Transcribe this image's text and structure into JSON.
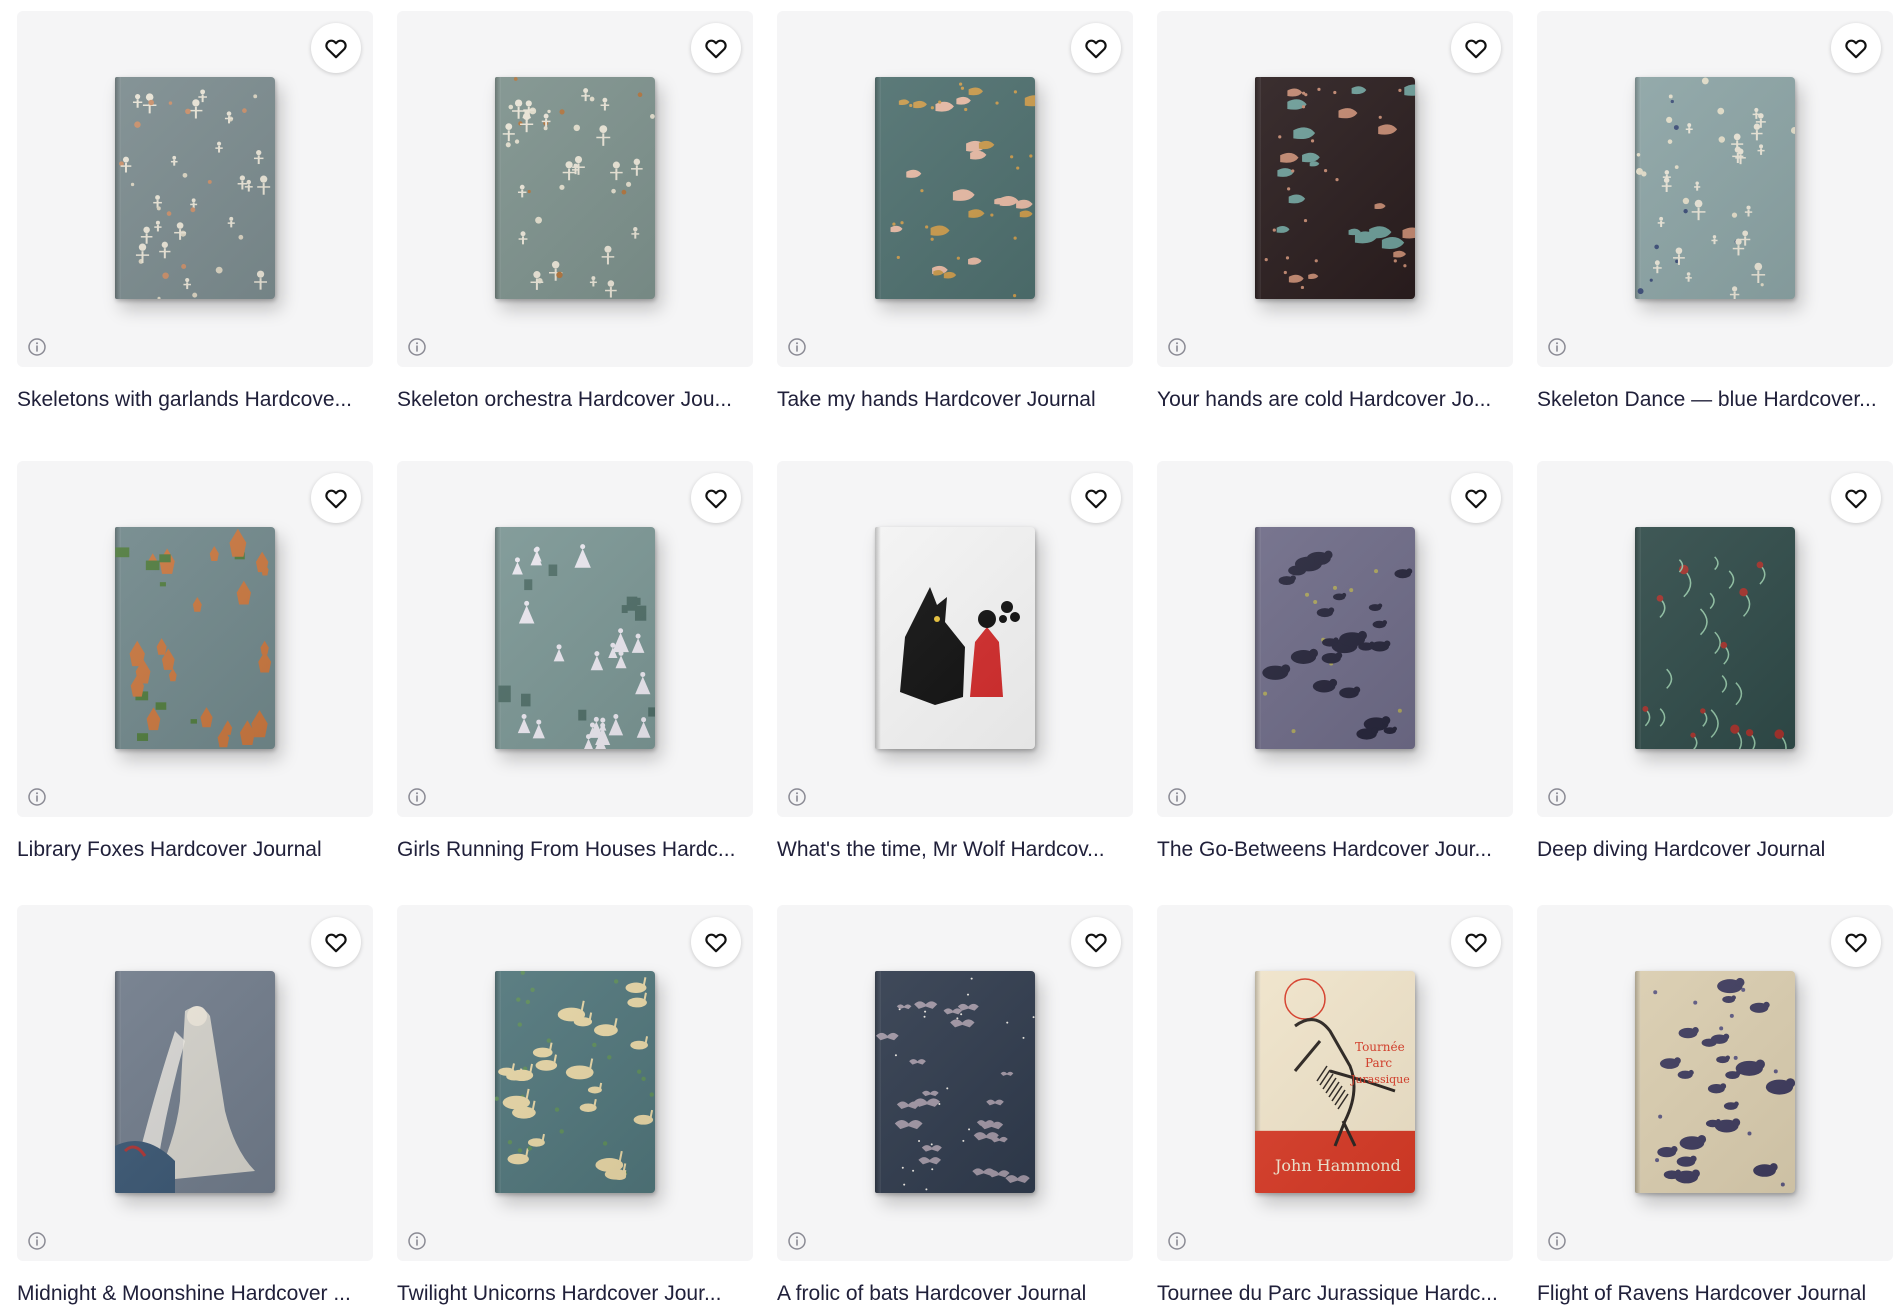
{
  "products": [
    {
      "title": "Skeletons with garlands Hardcove...",
      "cover": {
        "bg": "#7b8b8e",
        "accent": "#c98f6a",
        "accent2": "#d9d3c1",
        "motif": "skeleton"
      }
    },
    {
      "title": "Skeleton orchestra Hardcover Jou...",
      "cover": {
        "bg": "#7d918c",
        "accent": "#b0753f",
        "accent2": "#e0dccb",
        "motif": "skeleton"
      }
    },
    {
      "title": "Take my hands Hardcover Journal",
      "cover": {
        "bg": "#4e6f6e",
        "accent": "#e6b9a4",
        "accent2": "#c99a4c",
        "motif": "hands"
      }
    },
    {
      "title": "Your hands are cold Hardcover Jo...",
      "cover": {
        "bg": "#2a1d1e",
        "accent": "#6c9c97",
        "accent2": "#c0876f",
        "motif": "hands"
      }
    },
    {
      "title": "Skeleton Dance — blue Hardcover...",
      "cover": {
        "bg": "#8ba3a4",
        "accent": "#3c4d77",
        "accent2": "#e1dcc8",
        "motif": "skeleton"
      }
    },
    {
      "title": "Library Foxes Hardcover Journal",
      "cover": {
        "bg": "#70878a",
        "accent": "#c7763f",
        "accent2": "#4f7a3d",
        "motif": "fox"
      }
    },
    {
      "title": "Girls Running From Houses Hardc...",
      "cover": {
        "bg": "#7a9593",
        "accent": "#e9e6ee",
        "accent2": "#4f6d67",
        "motif": "girls"
      }
    },
    {
      "title": "What's the time, Mr Wolf Hardcov...",
      "cover": {
        "bg": "#f3f3f3",
        "accent": "#111111",
        "accent2": "#d12c2c",
        "motif": "wolf"
      }
    },
    {
      "title": "The Go-Betweens Hardcover Jour...",
      "cover": {
        "bg": "#6d6a86",
        "accent": "#26253a",
        "accent2": "#a9a25b",
        "motif": "birds"
      }
    },
    {
      "title": "Deep diving Hardcover Journal",
      "cover": {
        "bg": "#2f4a48",
        "accent": "#8fbfa2",
        "accent2": "#a2322c",
        "motif": "vines"
      }
    },
    {
      "title": "Midnight & Moonshine Hardcover ...",
      "cover": {
        "bg": "#6f7a89",
        "accent": "#dcd8cf",
        "accent2": "#3a5672",
        "motif": "woman"
      }
    },
    {
      "title": "Twilight Unicorns Hardcover Jour...",
      "cover": {
        "bg": "#4f7479",
        "accent": "#e4d3a3",
        "accent2": "#5b8a58",
        "motif": "unicorn"
      }
    },
    {
      "title": "A frolic of bats Hardcover Journal",
      "cover": {
        "bg": "#2f3a4c",
        "accent": "#9e94a2",
        "accent2": "#e9e6e0",
        "motif": "bats"
      }
    },
    {
      "title": "Tournee du Parc Jurassique Hardc...",
      "cover": {
        "bg": "#efe3c9",
        "accent": "#2a2420",
        "accent2": "#d63a26",
        "motif": "dino"
      }
    },
    {
      "title": "Flight of Ravens Hardcover Journal",
      "cover": {
        "bg": "#d9ccae",
        "accent": "#3d3a5c",
        "accent2": "#5b5780",
        "motif": "ravens"
      }
    }
  ],
  "icons": {
    "favorite": "heart-outline-icon",
    "info": "info-circle-icon"
  }
}
